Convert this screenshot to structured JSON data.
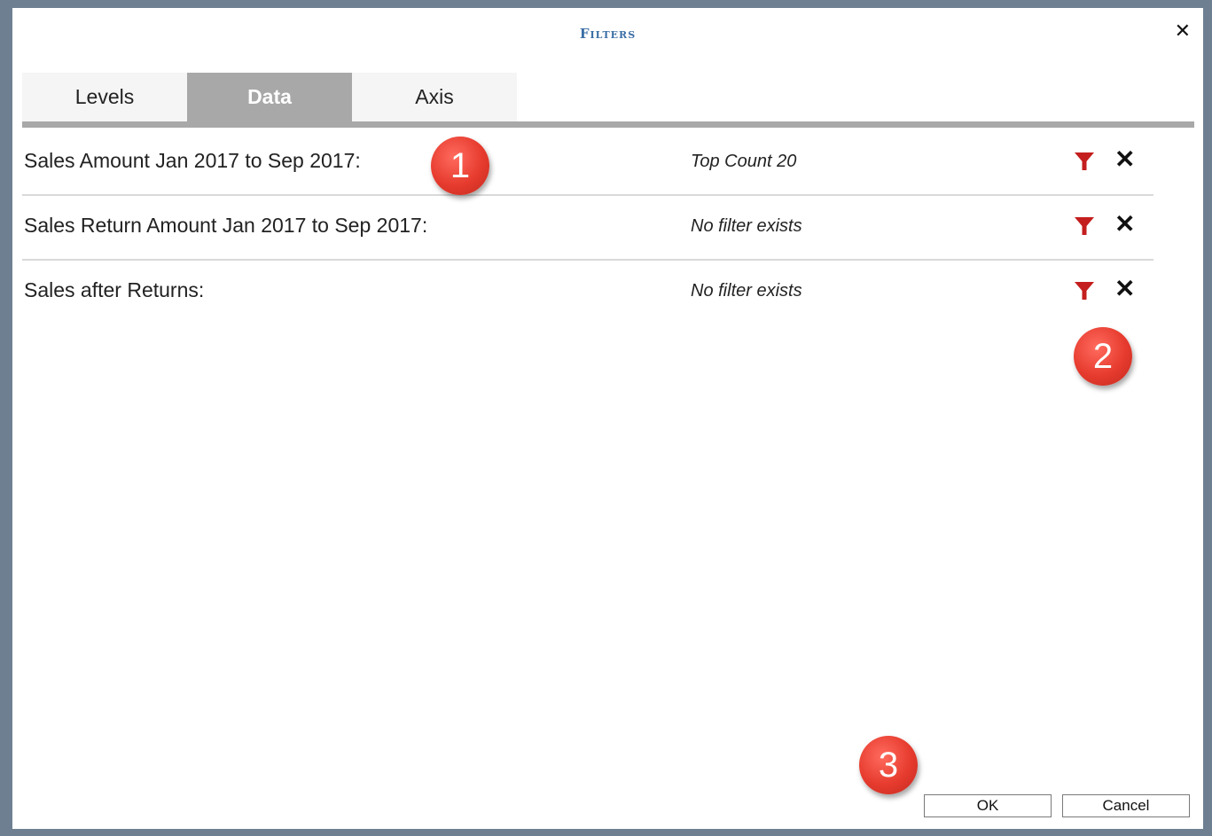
{
  "dialog": {
    "title": "Filters",
    "close_glyph": "✕"
  },
  "tabs": [
    {
      "label": "Levels",
      "active": false
    },
    {
      "label": "Data",
      "active": true
    },
    {
      "label": "Axis",
      "active": false
    }
  ],
  "rows": [
    {
      "label": "Sales Amount Jan 2017 to Sep 2017:",
      "status": "Top Count 20"
    },
    {
      "label": "Sales Return Amount Jan 2017 to Sep 2017:",
      "status": "No filter exists"
    },
    {
      "label": "Sales after Returns:",
      "status": "No filter exists"
    }
  ],
  "icons": {
    "filter": "filter-icon",
    "remove": "close-icon",
    "filter_color": "#c41e1e"
  },
  "markers": [
    "1",
    "2",
    "3"
  ],
  "buttons": {
    "ok": "OK",
    "cancel": "Cancel"
  },
  "colors": {
    "accent": "#3a6ea5",
    "tab_active": "#a8a8a8",
    "marker": "#e63b2e"
  }
}
